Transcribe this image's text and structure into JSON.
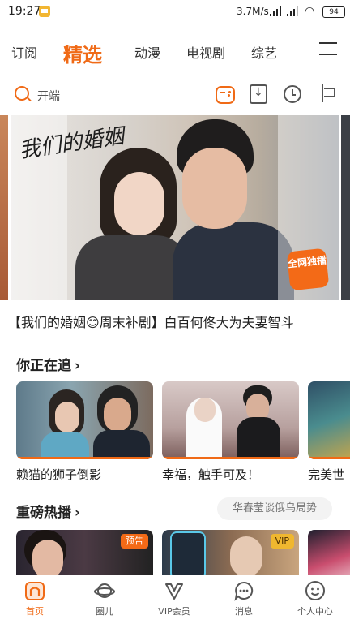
{
  "status_bar": {
    "time": "19:27",
    "network_speed": "3.7M/s",
    "battery": "94"
  },
  "tabs": [
    {
      "label": "订阅",
      "active": false
    },
    {
      "label": "精选",
      "active": true
    },
    {
      "label": "动漫",
      "active": false
    },
    {
      "label": "电视剧",
      "active": false
    },
    {
      "label": "综艺",
      "active": false
    }
  ],
  "search": {
    "text": "开端"
  },
  "hero": {
    "title_art": "我们的婚姻",
    "badge": "全网独播",
    "caption": "【我们的婚姻😊周末补剧】白百何佟大为夫妻智斗"
  },
  "following": {
    "title": "你正在追",
    "items": [
      {
        "title": "赖猫的狮子倒影"
      },
      {
        "title": "幸福，触手可及！"
      },
      {
        "title": "完美世"
      }
    ]
  },
  "hot": {
    "title": "重磅热播",
    "topic": "华春莹谈俄乌局势",
    "items": [
      {
        "badge": "预告"
      },
      {
        "badge": "VIP"
      },
      {
        "badge": ""
      }
    ]
  },
  "bottom_nav": [
    {
      "label": "首页",
      "icon": "home-icon",
      "active": true
    },
    {
      "label": "圈儿",
      "icon": "planet-icon",
      "active": false
    },
    {
      "label": "VIP会员",
      "icon": "vip-icon",
      "active": false
    },
    {
      "label": "消息",
      "icon": "message-icon",
      "active": false
    },
    {
      "label": "个人中心",
      "icon": "profile-icon",
      "active": false
    }
  ],
  "colors": {
    "accent": "#f06a16",
    "vip_gold": "#f0b72f"
  }
}
